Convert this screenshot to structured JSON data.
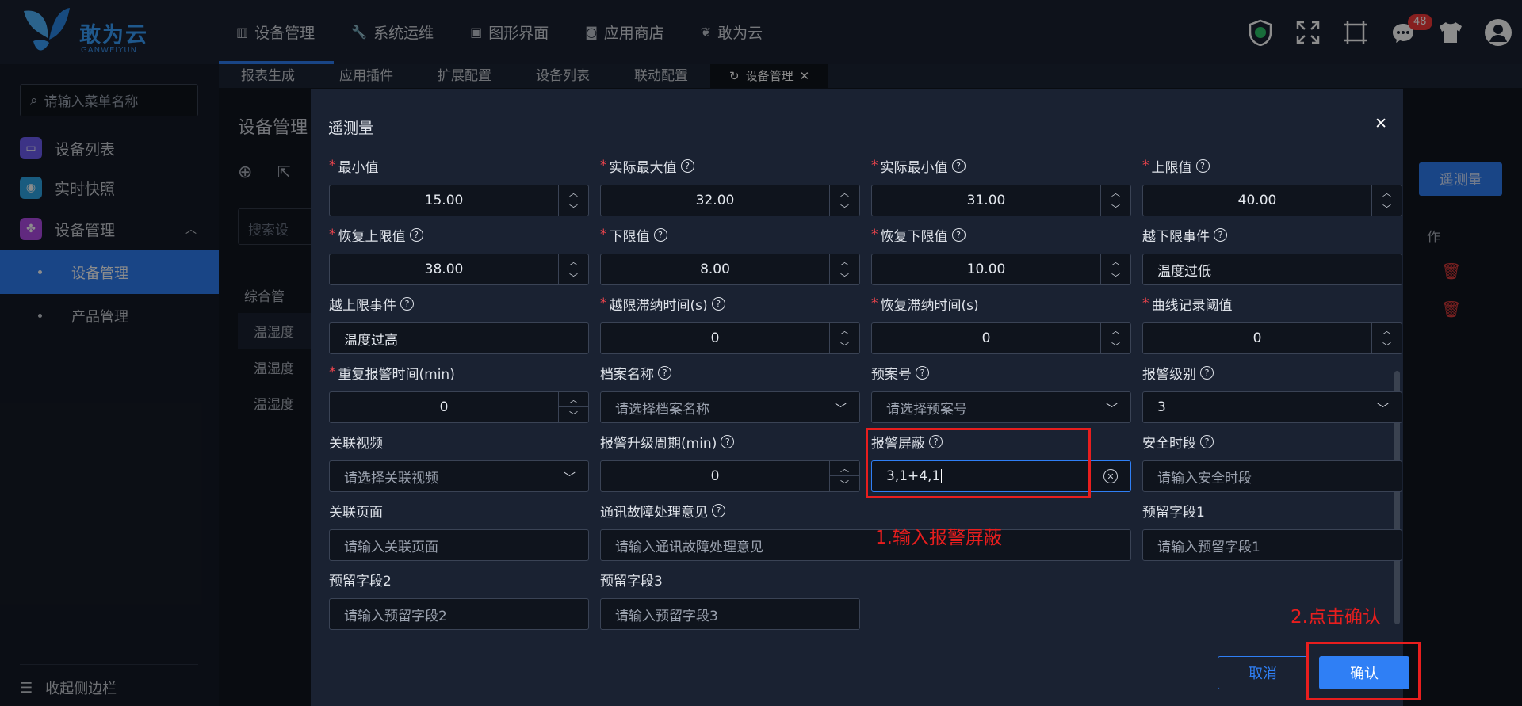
{
  "app": {
    "logo_text": "敢为云",
    "logo_sub": "GANWEIYUN"
  },
  "nav": [
    {
      "label": "设备管理",
      "icon": "▥"
    },
    {
      "label": "系统运维",
      "icon": "🔧"
    },
    {
      "label": "图形界面",
      "icon": "▣"
    },
    {
      "label": "应用商店",
      "icon": "◙"
    },
    {
      "label": "敢为云",
      "icon": "❦"
    }
  ],
  "top_right": {
    "badge": "48"
  },
  "sidebar": {
    "search_placeholder": "请输入菜单名称",
    "items": [
      {
        "label": "设备列表"
      },
      {
        "label": "实时快照"
      },
      {
        "label": "设备管理"
      }
    ],
    "subs": [
      {
        "label": "设备管理"
      },
      {
        "label": "产品管理"
      }
    ],
    "collapse": "收起侧边栏"
  },
  "tabs": [
    "报表生成",
    "应用插件",
    "扩展配置",
    "设备列表",
    "联动配置",
    "设备管理"
  ],
  "background": {
    "title": "设备管理",
    "search": "搜索设",
    "tree_root": "综合管",
    "rows": [
      "温湿度",
      "温湿度",
      "温湿度"
    ],
    "add_button": "遥测量",
    "col_header": "作"
  },
  "modal": {
    "title": "遥测量",
    "fields": {
      "min": {
        "label": "最小值",
        "value": "15.00"
      },
      "actual_max": {
        "label": "实际最大值",
        "value": "32.00"
      },
      "actual_min": {
        "label": "实际最小值",
        "value": "31.00"
      },
      "upper": {
        "label": "上限值",
        "value": "40.00"
      },
      "restore_upper": {
        "label": "恢复上限值",
        "value": "38.00"
      },
      "lower": {
        "label": "下限值",
        "value": "8.00"
      },
      "restore_lower": {
        "label": "恢复下限值",
        "value": "10.00"
      },
      "lower_event": {
        "label": "越下限事件",
        "value": "温度过低"
      },
      "upper_event": {
        "label": "越上限事件",
        "value": "温度过高"
      },
      "limit_delay": {
        "label": "越限滞纳时间(s)",
        "value": "0"
      },
      "restore_delay": {
        "label": "恢复滞纳时间(s)",
        "value": "0"
      },
      "curve_threshold": {
        "label": "曲线记录阈值",
        "value": "0"
      },
      "repeat_alarm": {
        "label": "重复报警时间(min)",
        "value": "0"
      },
      "archive": {
        "label": "档案名称",
        "placeholder": "请选择档案名称"
      },
      "plan": {
        "label": "预案号",
        "placeholder": "请选择预案号"
      },
      "alarm_level": {
        "label": "报警级别",
        "value": "3"
      },
      "video": {
        "label": "关联视频",
        "placeholder": "请选择关联视频"
      },
      "upgrade_period": {
        "label": "报警升级周期(min)",
        "value": "0"
      },
      "alarm_mask": {
        "label": "报警屏蔽",
        "value": "3,1+4,1"
      },
      "safe_period": {
        "label": "安全时段",
        "placeholder": "请输入安全时段"
      },
      "page": {
        "label": "关联页面",
        "placeholder": "请输入关联页面"
      },
      "fault_opinion": {
        "label": "通讯故障处理意见",
        "placeholder": "请输入通讯故障处理意见"
      },
      "reserve1": {
        "label": "预留字段1",
        "placeholder": "请输入预留字段1"
      },
      "reserve2": {
        "label": "预留字段2",
        "placeholder": "请输入预留字段2"
      },
      "reserve3": {
        "label": "预留字段3",
        "placeholder": "请输入预留字段3"
      }
    },
    "cancel": "取消",
    "confirm": "确认"
  },
  "annotations": {
    "step1": "1.输入报警屏蔽",
    "step2": "2.点击确认"
  },
  "colors": {
    "accent": "#2f7ff5",
    "annotation": "#e81e1e",
    "required": "#f5464e"
  }
}
